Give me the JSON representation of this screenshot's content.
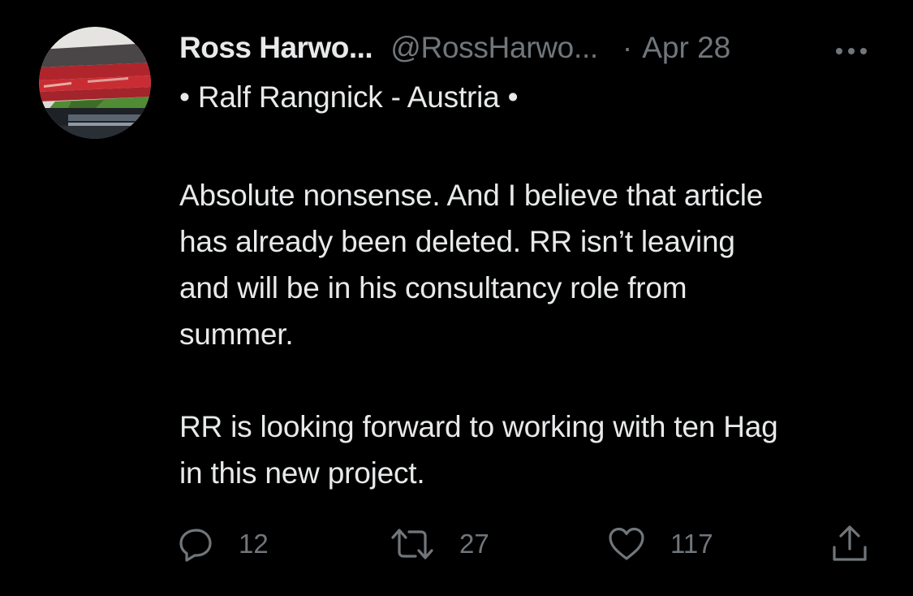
{
  "tweet": {
    "author": {
      "display_name": "Ross Harwo...",
      "handle": "@RossHarwo...",
      "name_suffix": "• Ralf Rangnick - Austria •",
      "avatar_icon": "stadium-photo-avatar"
    },
    "separator": "·",
    "timestamp": "Apr 28",
    "more_icon": "more-horizontal-icon",
    "paragraphs": [
      [
        "Absolute nonsense. And I believe that article",
        "has already been deleted. RR isn’t leaving",
        "and will be in his consultancy role from",
        "summer."
      ],
      [
        "RR is looking forward to working with ten Hag",
        "in this new project."
      ]
    ],
    "actions": {
      "reply": {
        "icon": "reply-icon",
        "count": "12"
      },
      "retweet": {
        "icon": "retweet-icon",
        "count": "27"
      },
      "like": {
        "icon": "heart-icon",
        "count": "117"
      },
      "share": {
        "icon": "share-icon"
      }
    }
  },
  "colors": {
    "background": "#000000",
    "primary_text": "#e7e9ea",
    "secondary_text": "#71767b"
  }
}
